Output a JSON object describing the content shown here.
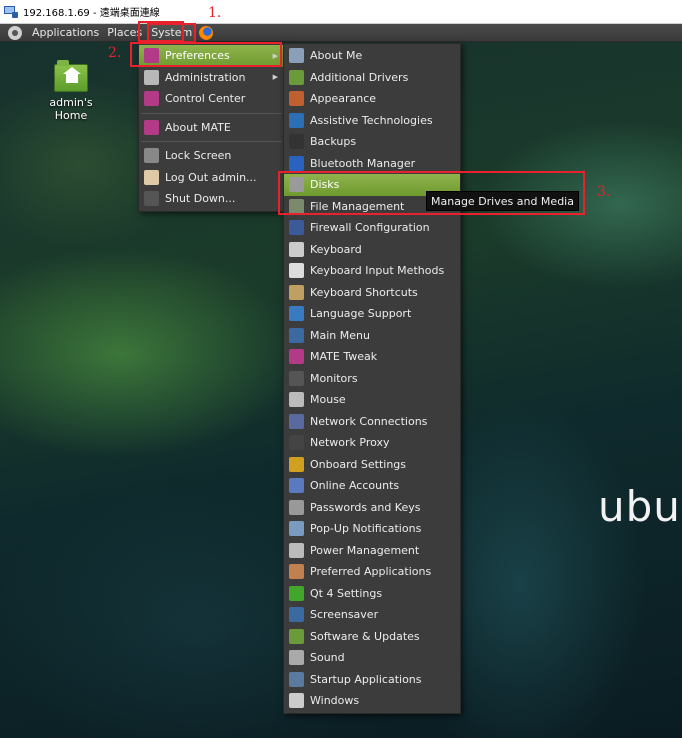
{
  "window": {
    "title": "192.168.1.69 - 遠端桌面連線"
  },
  "panel": {
    "applications": "Applications",
    "places": "Places",
    "system": "System"
  },
  "desktop": {
    "home_label": "admin's Home",
    "brand": "ubur"
  },
  "system_menu": {
    "items": [
      {
        "label": "Preferences",
        "icon": "preferences-icon",
        "color": "#b33a86",
        "active": true,
        "submenu": true
      },
      {
        "label": "Administration",
        "icon": "administration-icon",
        "color": "#b8b8b8",
        "submenu": true
      },
      {
        "label": "Control Center",
        "icon": "control-center-icon",
        "color": "#b33a86"
      },
      {
        "label": "About MATE",
        "icon": "about-mate-icon",
        "color": "#b33a86"
      },
      {
        "label": "Lock Screen",
        "icon": "lock-screen-icon",
        "color": "#888888"
      },
      {
        "label": "Log Out admin...",
        "icon": "user-icon",
        "color": "#e0c9a6"
      },
      {
        "label": "Shut Down...",
        "icon": "power-icon",
        "color": "#555555"
      }
    ]
  },
  "preferences_menu": {
    "items": [
      {
        "label": "About Me",
        "icon": "about-me-icon",
        "color": "#8aa0b8"
      },
      {
        "label": "Additional Drivers",
        "icon": "drivers-icon",
        "color": "#6a9a3a"
      },
      {
        "label": "Appearance",
        "icon": "appearance-icon",
        "color": "#c06030"
      },
      {
        "label": "Assistive Technologies",
        "icon": "accessibility-icon",
        "color": "#2d6fb5"
      },
      {
        "label": "Backups",
        "icon": "backups-icon",
        "color": "#333333"
      },
      {
        "label": "Bluetooth Manager",
        "icon": "bluetooth-icon",
        "color": "#2a62c0"
      },
      {
        "label": "Disks",
        "icon": "disks-icon",
        "color": "#9a9a9a",
        "active": true
      },
      {
        "label": "File Management",
        "icon": "file-management-icon",
        "color": "#7a8a6a"
      },
      {
        "label": "Firewall Configuration",
        "icon": "firewall-icon",
        "color": "#3a5a9a"
      },
      {
        "label": "Keyboard",
        "icon": "keyboard-icon",
        "color": "#cccccc"
      },
      {
        "label": "Keyboard Input Methods",
        "icon": "input-methods-icon",
        "color": "#dddddd"
      },
      {
        "label": "Keyboard Shortcuts",
        "icon": "keyboard-shortcuts-icon",
        "color": "#c0a060"
      },
      {
        "label": "Language Support",
        "icon": "language-icon",
        "color": "#3a7ac0"
      },
      {
        "label": "Main Menu",
        "icon": "main-menu-icon",
        "color": "#3a6aa0"
      },
      {
        "label": "MATE Tweak",
        "icon": "mate-tweak-icon",
        "color": "#b33a86"
      },
      {
        "label": "Monitors",
        "icon": "monitors-icon",
        "color": "#555555"
      },
      {
        "label": "Mouse",
        "icon": "mouse-icon",
        "color": "#bbbbbb"
      },
      {
        "label": "Network Connections",
        "icon": "network-connections-icon",
        "color": "#5a6aa0"
      },
      {
        "label": "Network Proxy",
        "icon": "network-proxy-icon",
        "color": "#444444"
      },
      {
        "label": "Onboard Settings",
        "icon": "onboard-icon",
        "color": "#d0a020"
      },
      {
        "label": "Online Accounts",
        "icon": "online-accounts-icon",
        "color": "#5a7ac0"
      },
      {
        "label": "Passwords and Keys",
        "icon": "passwords-icon",
        "color": "#999999"
      },
      {
        "label": "Pop-Up Notifications",
        "icon": "notifications-icon",
        "color": "#7a9ac0"
      },
      {
        "label": "Power Management",
        "icon": "power-management-icon",
        "color": "#bbbbbb"
      },
      {
        "label": "Preferred Applications",
        "icon": "preferred-apps-icon",
        "color": "#c08050"
      },
      {
        "label": "Qt 4 Settings",
        "icon": "qt-icon",
        "color": "#41a62a"
      },
      {
        "label": "Screensaver",
        "icon": "screensaver-icon",
        "color": "#3a6aa0"
      },
      {
        "label": "Software & Updates",
        "icon": "software-updates-icon",
        "color": "#6a9a3a"
      },
      {
        "label": "Sound",
        "icon": "sound-icon",
        "color": "#aaaaaa"
      },
      {
        "label": "Startup Applications",
        "icon": "startup-icon",
        "color": "#5a7aa0"
      },
      {
        "label": "Windows",
        "icon": "windows-icon",
        "color": "#cccccc"
      }
    ]
  },
  "tooltip": "Manage Drives and Media",
  "annotations": {
    "step1": "1.",
    "step2": "2.",
    "step3": "3.",
    "color": "#e8212d"
  }
}
